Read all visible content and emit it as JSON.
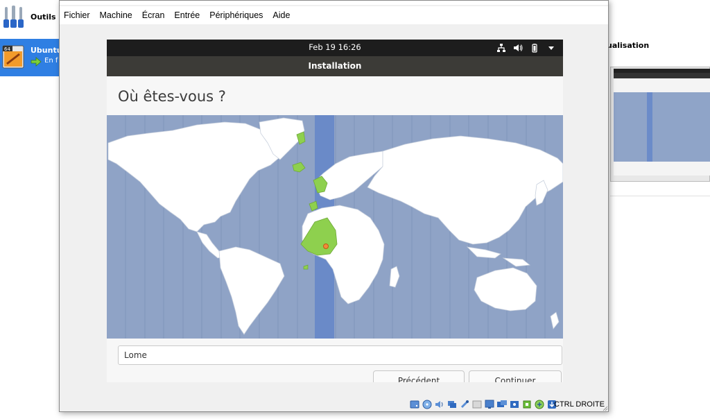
{
  "manager": {
    "tools_label": "Outils",
    "vm": {
      "name": "Ubuntu",
      "state": "En f",
      "badge": "64"
    },
    "preview_title": "ualisation"
  },
  "vm_window": {
    "menu": [
      "Fichier",
      "Machine",
      "Écran",
      "Entrée",
      "Périphériques",
      "Aide"
    ],
    "statusbar": {
      "host_key": "CTRL DROITE",
      "icons": [
        "hard-disk-icon",
        "optical-drive-icon",
        "audio-icon",
        "network-icon",
        "usb-icon",
        "shared-folders-icon",
        "display-icon",
        "screen-capture-icon",
        "recording-icon",
        "cpu-icon",
        "mouse-integration-icon",
        "keyboard-icon"
      ]
    }
  },
  "guest": {
    "topbar": {
      "clock": "Feb 19  16:26",
      "tray_icons": [
        "network-icon",
        "volume-icon",
        "battery-icon",
        "dropdown-arrow-icon"
      ]
    },
    "installer": {
      "header_title": "Installation",
      "question": "Où êtes-vous ?",
      "location_value": "Lome",
      "buttons": {
        "previous": "Précédent",
        "continue": "Continuer"
      }
    }
  },
  "colors": {
    "map_ocean": "#8fa3c6",
    "map_land": "#ffffff",
    "timezone_stripe": "#6a8ac8",
    "selected_zone": "#8ed04e",
    "location_marker": "#f08a3c",
    "gnome_bar": "#1d1d1d",
    "installer_header": "#3c3b37",
    "vm_selected": "#2f7fe3"
  }
}
